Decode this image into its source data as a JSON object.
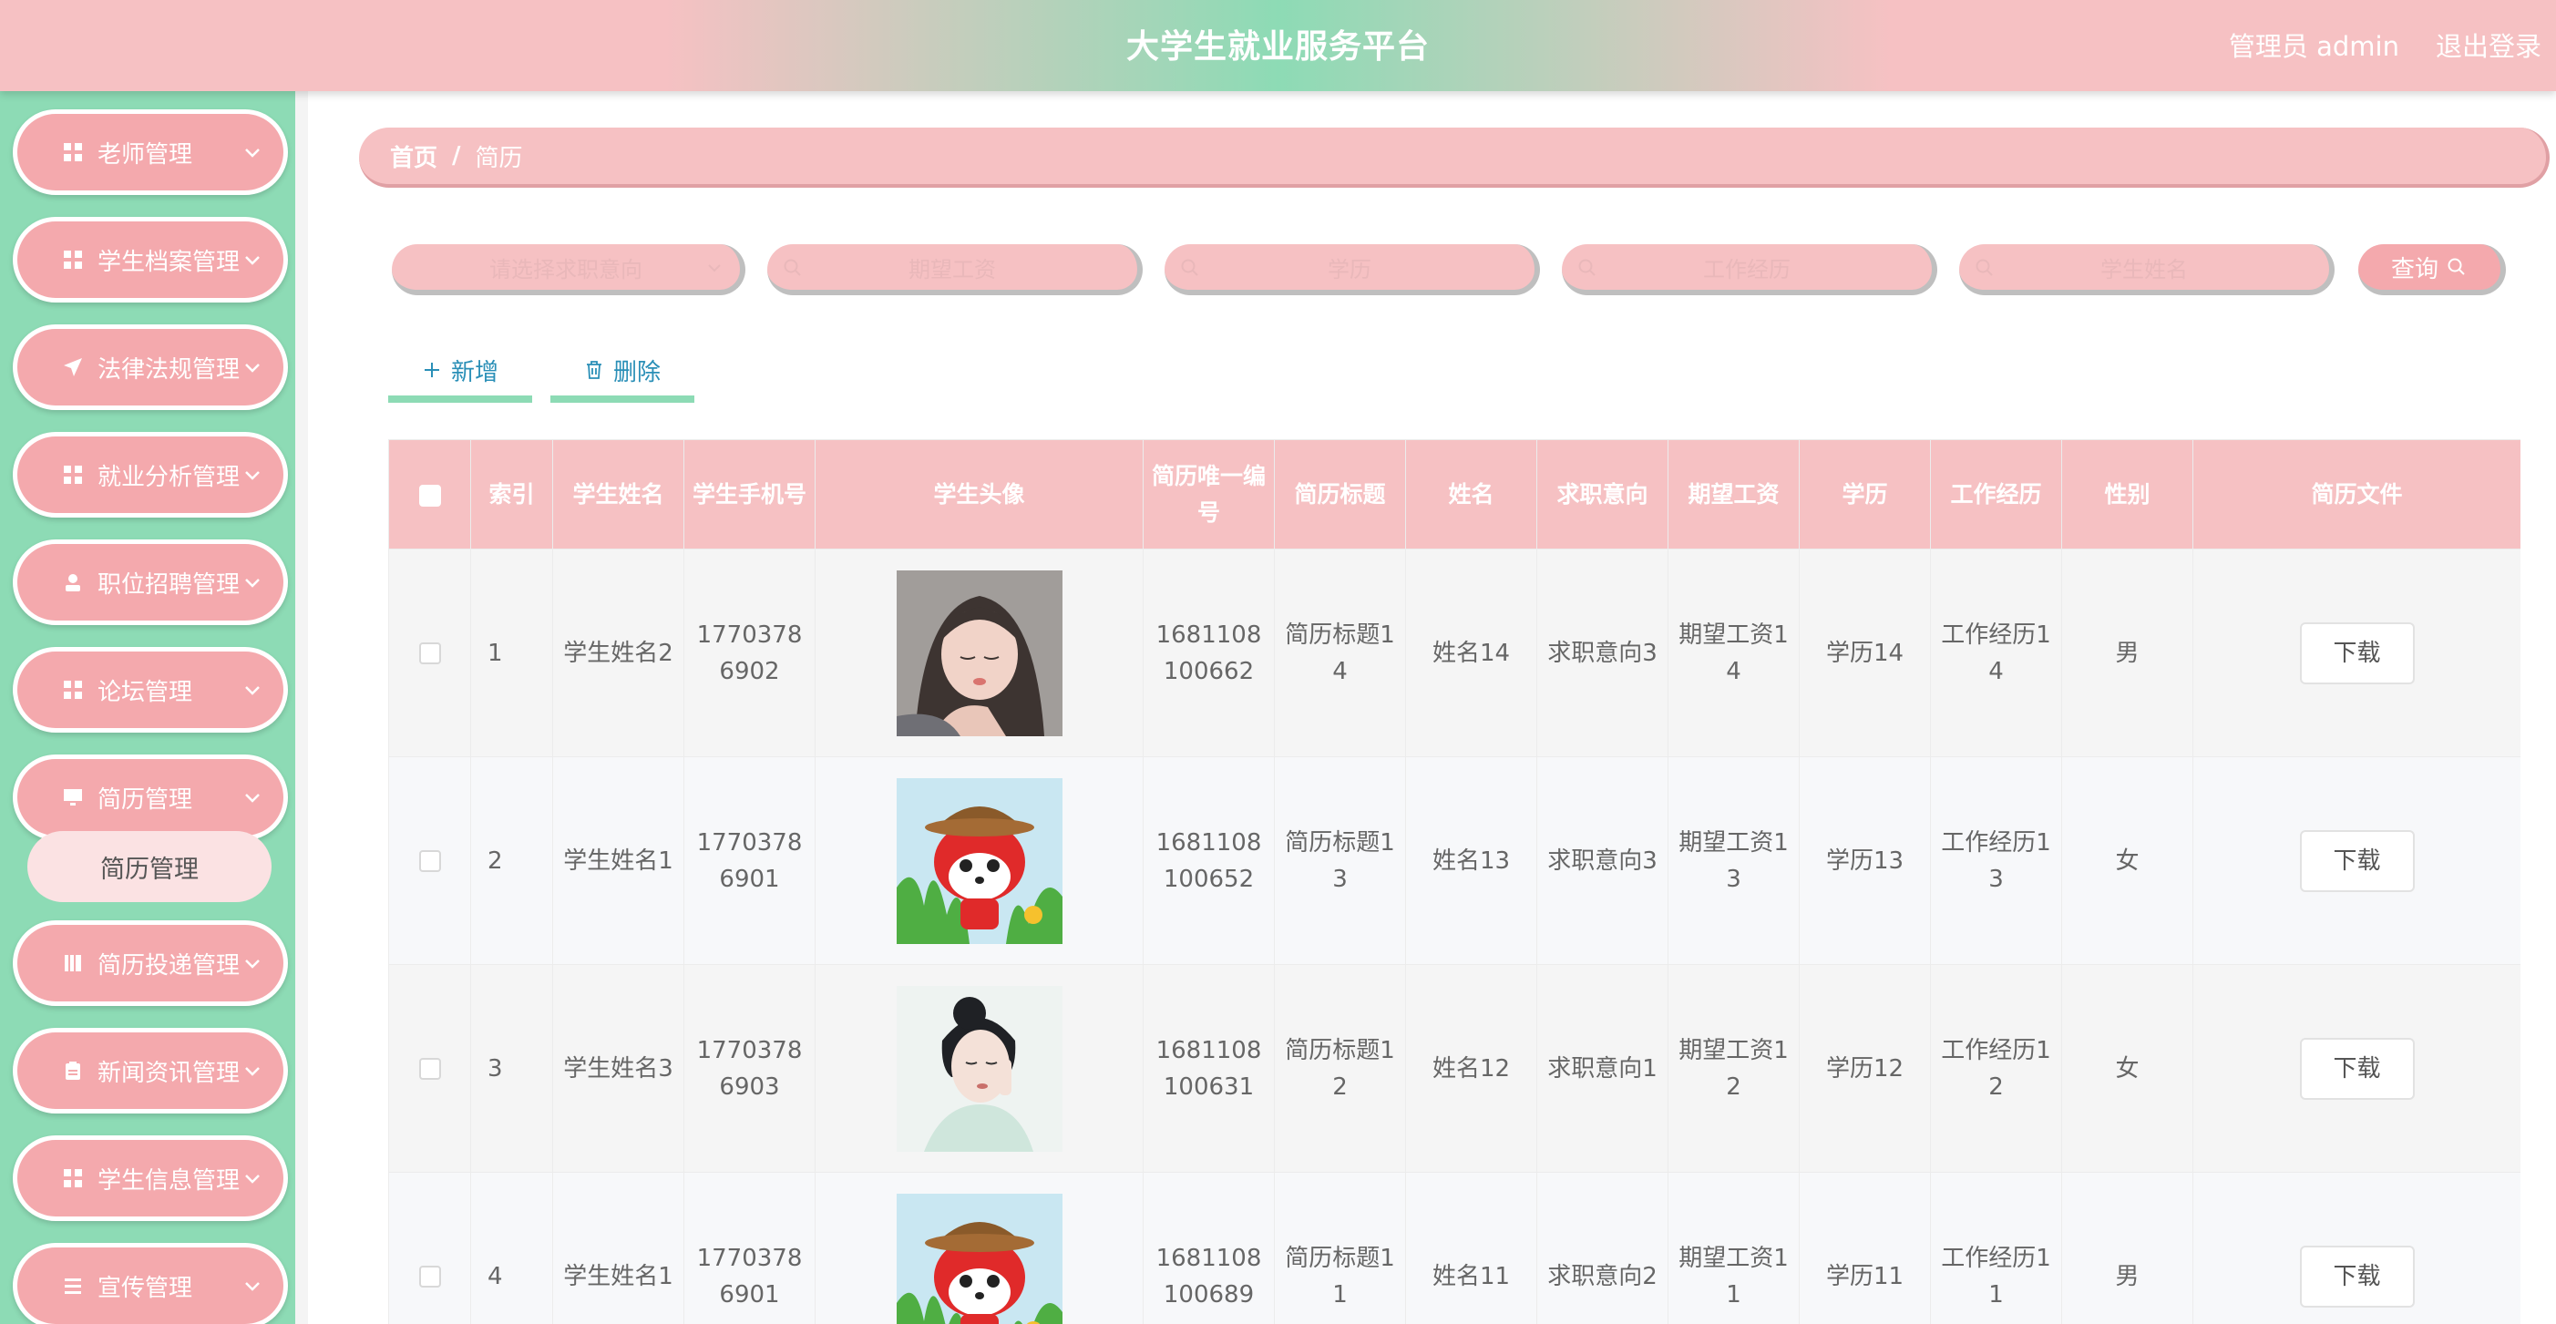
{
  "header": {
    "title": "大学生就业服务平台",
    "admin_label": "管理员 admin",
    "logout_label": "退出登录"
  },
  "sidebar": {
    "items": [
      {
        "label": "老师管理",
        "icon": "grid-icon"
      },
      {
        "label": "学生档案管理",
        "icon": "grid-icon"
      },
      {
        "label": "法律法规管理",
        "icon": "send-icon"
      },
      {
        "label": "就业分析管理",
        "icon": "grid-icon"
      },
      {
        "label": "职位招聘管理",
        "icon": "user-icon"
      },
      {
        "label": "论坛管理",
        "icon": "grid-icon"
      },
      {
        "label": "简历管理",
        "icon": "monitor-icon"
      },
      {
        "label": "简历投递管理",
        "icon": "book-icon"
      },
      {
        "label": "新闻资讯管理",
        "icon": "clipboard-icon"
      },
      {
        "label": "学生信息管理",
        "icon": "grid-icon"
      },
      {
        "label": "宣传管理",
        "icon": "list-icon"
      }
    ],
    "active_submenu": "简历管理"
  },
  "breadcrumb": {
    "home": "首页",
    "separator": "/",
    "current": "简历"
  },
  "search": {
    "job_intent_placeholder": "请选择求职意向",
    "salary_placeholder": "期望工资",
    "education_placeholder": "学历",
    "experience_placeholder": "工作经历",
    "student_name_placeholder": "学生姓名",
    "query_label": "查询"
  },
  "actions": {
    "add_label": "新增",
    "delete_label": "删除"
  },
  "table": {
    "headers": {
      "index": "索引",
      "student_name": "学生姓名",
      "student_phone": "学生手机号",
      "student_avatar": "学生头像",
      "resume_id": "简历唯一编号",
      "resume_title": "简历标题",
      "name": "姓名",
      "job_intent": "求职意向",
      "expected_salary": "期望工资",
      "education": "学历",
      "experience": "工作经历",
      "gender": "性别",
      "resume_file": "简历文件"
    },
    "rows": [
      {
        "index": "1",
        "student_name": "学生姓名2",
        "phone": "17703786902",
        "avatar": "photo-girl-icon",
        "resume_id": "1681108100662",
        "title": "简历标题14",
        "name": "姓名14",
        "intent": "求职意向3",
        "salary": "期望工资14",
        "education": "学历14",
        "experience": "工作经历14",
        "gender": "男",
        "download": "下载"
      },
      {
        "index": "2",
        "student_name": "学生姓名1",
        "phone": "17703786901",
        "avatar": "cartoon-fox-icon",
        "resume_id": "1681108100652",
        "title": "简历标题13",
        "name": "姓名13",
        "intent": "求职意向3",
        "salary": "期望工资13",
        "education": "学历13",
        "experience": "工作经历13",
        "gender": "女",
        "download": "下载"
      },
      {
        "index": "3",
        "student_name": "学生姓名3",
        "phone": "17703786903",
        "avatar": "photo-woman-icon",
        "resume_id": "1681108100631",
        "title": "简历标题12",
        "name": "姓名12",
        "intent": "求职意向1",
        "salary": "期望工资12",
        "education": "学历12",
        "experience": "工作经历12",
        "gender": "女",
        "download": "下载"
      },
      {
        "index": "4",
        "student_name": "学生姓名1",
        "phone": "17703786901",
        "avatar": "cartoon-fox-icon",
        "resume_id": "1681108100689",
        "title": "简历标题11",
        "name": "姓名11",
        "intent": "求职意向2",
        "salary": "期望工资11",
        "education": "学历11",
        "experience": "工作经历11",
        "gender": "男",
        "download": "下载"
      }
    ]
  },
  "colors": {
    "pink": "#f6c1c3",
    "pink_dark": "#f4a9ad",
    "mint": "#8ddbb5",
    "link_blue": "#2a8fb7"
  }
}
